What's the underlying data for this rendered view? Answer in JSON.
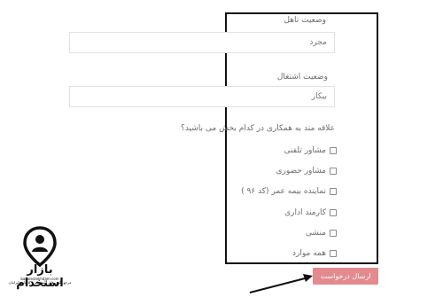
{
  "form": {
    "marital_status_label": "وضعیت تاهل",
    "marital_status_value": "مجرد",
    "employment_status_label": "وضعیت اشتغال",
    "employment_status_value": "بیکار",
    "interest_question": "علاقه مند به همکاری در کدام بخش می باشید؟",
    "options": [
      {
        "label": "مشاور تلفنی",
        "checked": false
      },
      {
        "label": "مشاور حضوری",
        "checked": false
      },
      {
        "label": "نماینده بیمه عمر (کد ۹۶ )",
        "checked": false
      },
      {
        "label": "کارمند اداری",
        "checked": false
      },
      {
        "label": "منشی",
        "checked": false
      },
      {
        "label": "همه موارد",
        "checked": false
      }
    ],
    "submit_label": "ارسال درخواست"
  },
  "watermark": {
    "brand": "بازار استخدام",
    "domain": "bazarestekhdam.com",
    "tagline": "مرجع آگهی های استخدام و کاریابی ایرانیان"
  },
  "colors": {
    "submit_bg": "#e28a8d",
    "frame": "#111111",
    "field_border": "#e2e2e2"
  }
}
